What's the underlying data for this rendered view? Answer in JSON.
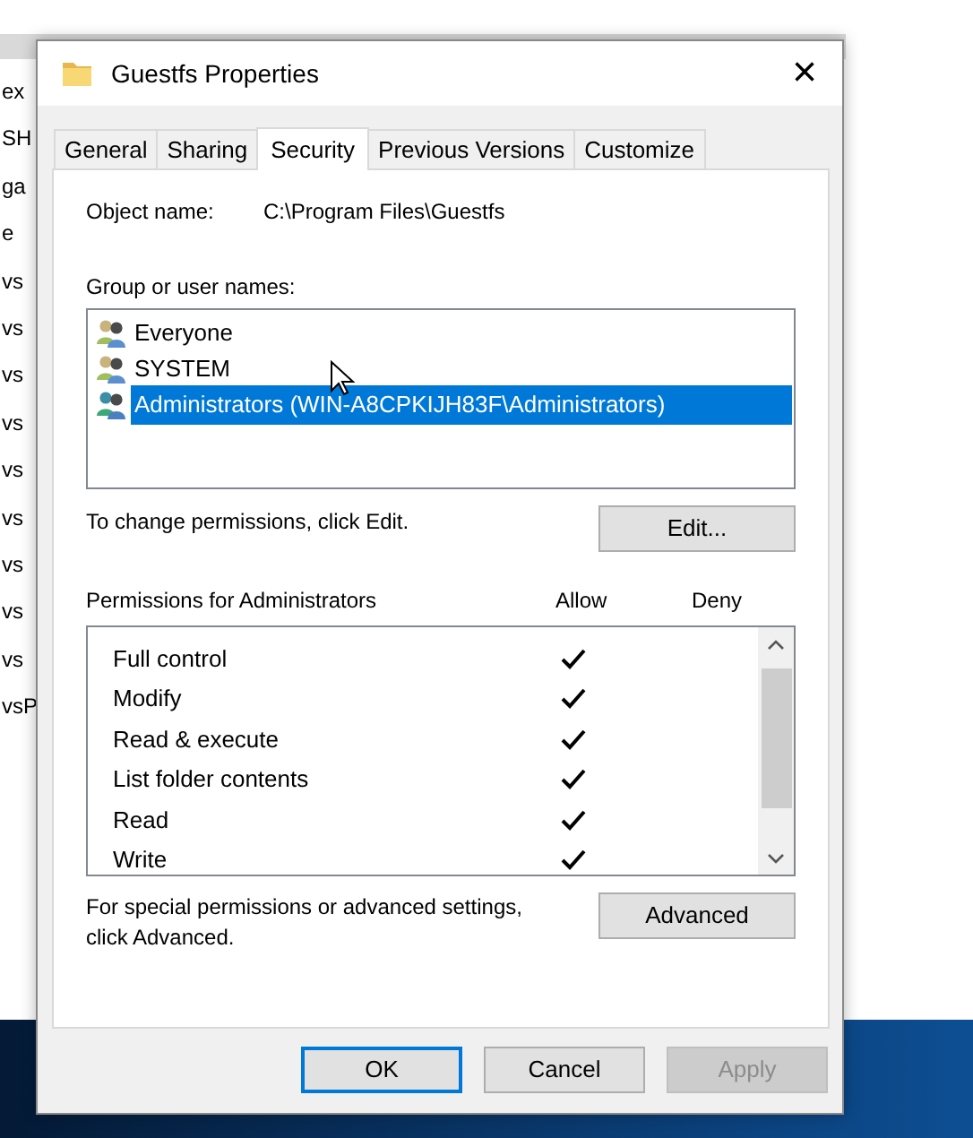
{
  "background": {
    "left_items": [
      "ex",
      "SH",
      "ga",
      "e",
      "vs",
      "vs",
      "vs",
      "vs",
      "vs",
      "vs",
      "vs",
      "vs",
      "vs",
      "vsP"
    ]
  },
  "window": {
    "title": "Guestfs Properties",
    "close": "×"
  },
  "tabs": [
    {
      "label": "General",
      "selected": false
    },
    {
      "label": "Sharing",
      "selected": false
    },
    {
      "label": "Security",
      "selected": true
    },
    {
      "label": "Previous Versions",
      "selected": false
    },
    {
      "label": "Customize",
      "selected": false
    }
  ],
  "object_name": {
    "label": "Object name:",
    "value": "C:\\Program Files\\Guestfs"
  },
  "groups": {
    "label": "Group or user names:",
    "items": [
      {
        "name": "Everyone",
        "kind": "user",
        "selected": false
      },
      {
        "name": "SYSTEM",
        "kind": "user",
        "selected": false
      },
      {
        "name": "Administrators (WIN-A8CPKIJH83F\\Administrators)",
        "kind": "group",
        "selected": true
      }
    ]
  },
  "change_hint": "To change permissions, click Edit.",
  "edit_button": "Edit...",
  "permissions": {
    "label": "Permissions for Administrators",
    "allow_header": "Allow",
    "deny_header": "Deny",
    "rows": [
      {
        "name": "Full control",
        "allow": true,
        "deny": false
      },
      {
        "name": "Modify",
        "allow": true,
        "deny": false
      },
      {
        "name": "Read & execute",
        "allow": true,
        "deny": false
      },
      {
        "name": "List folder contents",
        "allow": true,
        "deny": false
      },
      {
        "name": "Read",
        "allow": true,
        "deny": false
      },
      {
        "name": "Write",
        "allow": true,
        "deny": false
      }
    ]
  },
  "advanced_hint": "For special permissions or advanced settings, click Advanced.",
  "advanced_button": "Advanced",
  "buttons": [
    {
      "label": "OK",
      "kind": "default",
      "disabled": false
    },
    {
      "label": "Cancel",
      "kind": "normal",
      "disabled": false
    },
    {
      "label": "Apply",
      "kind": "normal",
      "disabled": true
    }
  ]
}
